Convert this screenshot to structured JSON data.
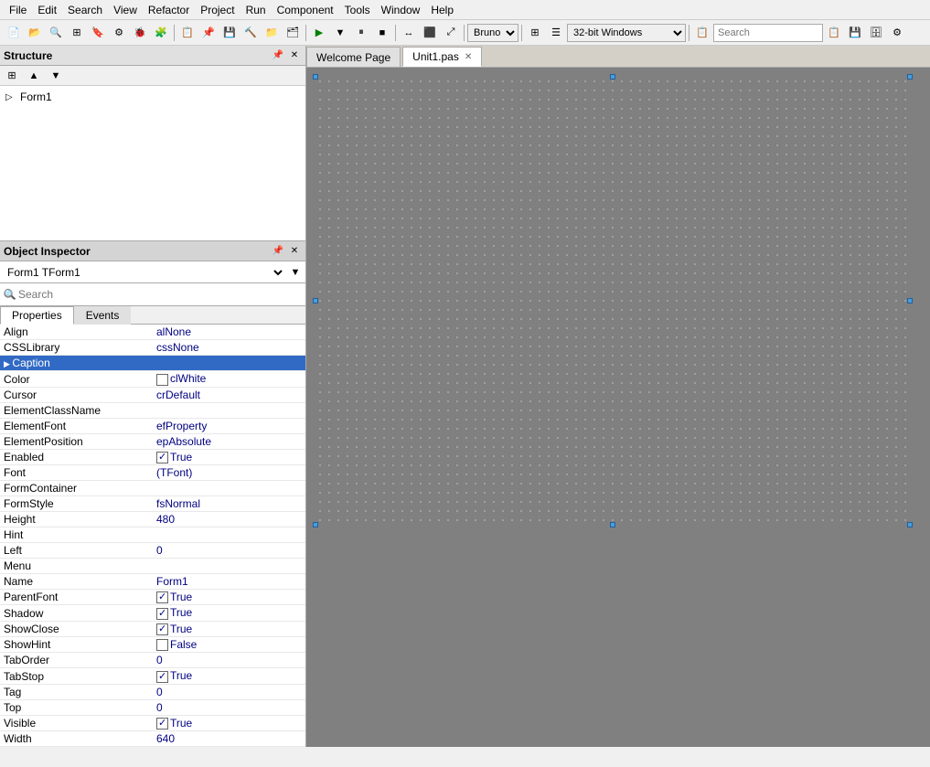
{
  "menubar": {
    "items": [
      "File",
      "Edit",
      "Search",
      "View",
      "Refactor",
      "Project",
      "Run",
      "Component",
      "Tools",
      "Window",
      "Help"
    ]
  },
  "toolbar": {
    "profile_select": "Bruno",
    "build_select": "32-bit Windows",
    "search_placeholder": "Search"
  },
  "structure_panel": {
    "title": "Structure",
    "tree": [
      {
        "label": "Form1",
        "indent": 0
      }
    ]
  },
  "object_inspector": {
    "title": "Object Inspector",
    "selected_object": "Form1  TForm1",
    "search_placeholder": "Search",
    "tabs": [
      "Properties",
      "Events"
    ],
    "active_tab": "Properties",
    "properties": [
      {
        "name": "Align",
        "value": "alNone",
        "type": "text"
      },
      {
        "name": "CSSLibrary",
        "value": "cssNone",
        "type": "text"
      },
      {
        "name": "Caption",
        "value": "",
        "type": "text",
        "selected": true
      },
      {
        "name": "Color",
        "value": "clWhite",
        "type": "color",
        "color": "#ffffff"
      },
      {
        "name": "Cursor",
        "value": "crDefault",
        "type": "text"
      },
      {
        "name": "ElementClassName",
        "value": "",
        "type": "text"
      },
      {
        "name": "ElementFont",
        "value": "efProperty",
        "type": "text"
      },
      {
        "name": "ElementPosition",
        "value": "epAbsolute",
        "type": "text"
      },
      {
        "name": "Enabled",
        "value": "True",
        "type": "checkbox",
        "checked": true
      },
      {
        "name": "Font",
        "value": "(TFont)",
        "type": "text"
      },
      {
        "name": "FormContainer",
        "value": "",
        "type": "text"
      },
      {
        "name": "FormStyle",
        "value": "fsNormal",
        "type": "text"
      },
      {
        "name": "Height",
        "value": "480",
        "type": "text"
      },
      {
        "name": "Hint",
        "value": "",
        "type": "text"
      },
      {
        "name": "Left",
        "value": "0",
        "type": "text"
      },
      {
        "name": "Menu",
        "value": "",
        "type": "text"
      },
      {
        "name": "Name",
        "value": "Form1",
        "type": "text"
      },
      {
        "name": "ParentFont",
        "value": "True",
        "type": "checkbox",
        "checked": true
      },
      {
        "name": "Shadow",
        "value": "True",
        "type": "checkbox",
        "checked": true
      },
      {
        "name": "ShowClose",
        "value": "True",
        "type": "checkbox",
        "checked": true
      },
      {
        "name": "ShowHint",
        "value": "False",
        "type": "checkbox",
        "checked": false
      },
      {
        "name": "TabOrder",
        "value": "0",
        "type": "text"
      },
      {
        "name": "TabStop",
        "value": "True",
        "type": "checkbox",
        "checked": true
      },
      {
        "name": "Tag",
        "value": "0",
        "type": "text"
      },
      {
        "name": "Top",
        "value": "0",
        "type": "text"
      },
      {
        "name": "Visible",
        "value": "True",
        "type": "checkbox",
        "checked": true
      },
      {
        "name": "Width",
        "value": "640",
        "type": "text"
      }
    ]
  },
  "tabs": [
    {
      "label": "Welcome Page",
      "active": false,
      "closable": false
    },
    {
      "label": "Unit1.pas",
      "active": true,
      "closable": true
    }
  ],
  "icons": {
    "search": "🔍",
    "expand": "▷",
    "collapse": "▽",
    "up": "▲",
    "down": "▼",
    "close": "✕",
    "pin": "📌",
    "arrow_up": "↑",
    "arrow_down": "↓"
  }
}
